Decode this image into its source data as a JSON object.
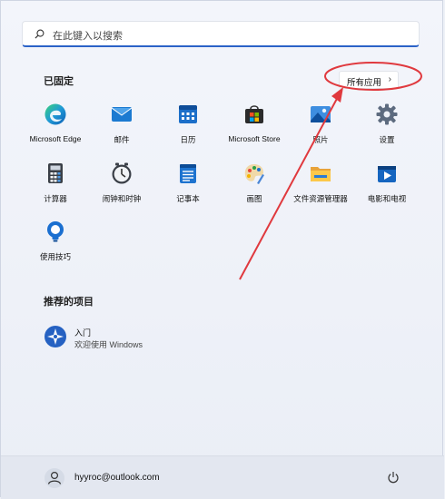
{
  "search": {
    "placeholder": "在此键入以搜索"
  },
  "pinned": {
    "title": "已固定",
    "all_apps_label": "所有应用",
    "all_apps_chevron": "›",
    "apps": [
      {
        "label": "Microsoft Edge",
        "icon": "edge-icon"
      },
      {
        "label": "邮件",
        "icon": "mail-icon"
      },
      {
        "label": "日历",
        "icon": "calendar-icon"
      },
      {
        "label": "Microsoft Store",
        "icon": "store-icon"
      },
      {
        "label": "照片",
        "icon": "photos-icon"
      },
      {
        "label": "设置",
        "icon": "settings-icon"
      },
      {
        "label": "计算器",
        "icon": "calculator-icon"
      },
      {
        "label": "闹钟和时钟",
        "icon": "clock-icon"
      },
      {
        "label": "记事本",
        "icon": "notepad-icon"
      },
      {
        "label": "画图",
        "icon": "paint-icon"
      },
      {
        "label": "文件资源管理器",
        "icon": "folder-icon"
      },
      {
        "label": "电影和电视",
        "icon": "movies-icon"
      },
      {
        "label": "使用技巧",
        "icon": "tips-icon"
      }
    ]
  },
  "recommended": {
    "title": "推荐的项目",
    "items": [
      {
        "title": "入门",
        "subtitle": "欢迎使用 Windows",
        "icon": "getstarted-icon"
      }
    ]
  },
  "footer": {
    "user": "hyyroc@outlook.com"
  },
  "colors": {
    "accent": "#2b62c7",
    "annotation": "#e0393e"
  }
}
